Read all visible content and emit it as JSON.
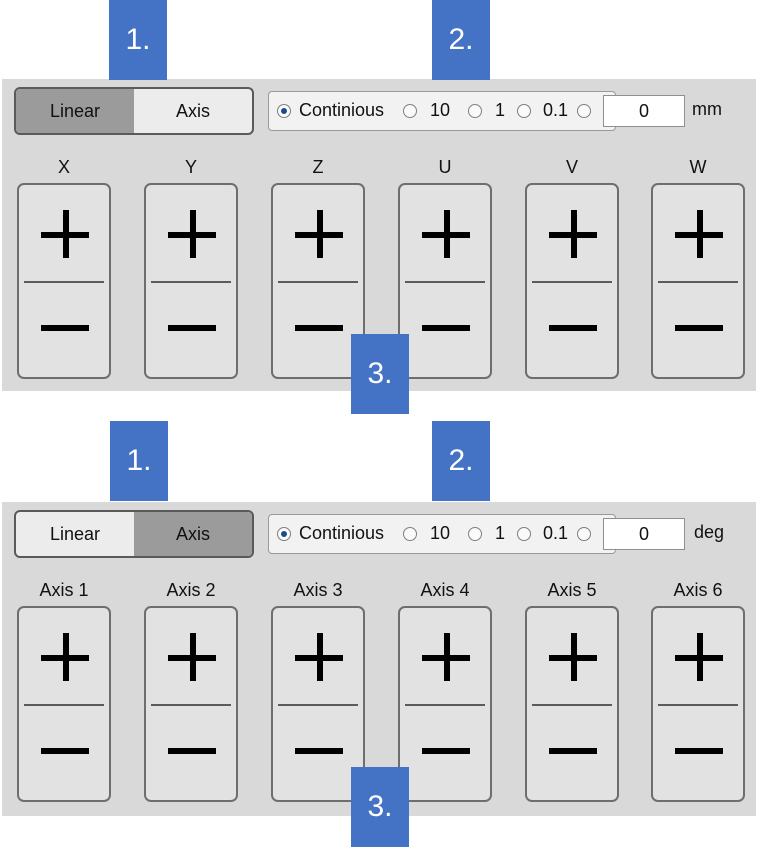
{
  "callouts": {
    "one": "1.",
    "two": "2.",
    "three": "3."
  },
  "modes": [
    "Linear",
    "Axis"
  ],
  "step_options": [
    "Continious",
    "10",
    "1",
    "0.1"
  ],
  "panel_a": {
    "active_mode": "Linear",
    "step_value": "0",
    "unit": "mm",
    "axes": [
      "X",
      "Y",
      "Z",
      "U",
      "V",
      "W"
    ]
  },
  "panel_b": {
    "active_mode": "Axis",
    "step_value": "0",
    "unit": "deg",
    "axes": [
      "Axis 1",
      "Axis 2",
      "Axis 3",
      "Axis 4",
      "Axis 5",
      "Axis 6"
    ]
  },
  "colors": {
    "callout": "#4472c4",
    "panel": "#d9d9d9",
    "active_mode": "#9b9b9b"
  }
}
